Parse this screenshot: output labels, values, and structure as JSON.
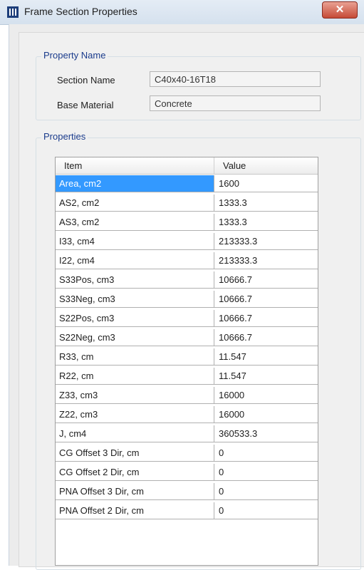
{
  "window": {
    "title": "Frame Section Properties",
    "close_glyph": "✕"
  },
  "property_name": {
    "legend": "Property Name",
    "section_name_label": "Section Name",
    "section_name_value": "C40x40-16T18",
    "base_material_label": "Base Material",
    "base_material_value": "Concrete"
  },
  "properties": {
    "legend": "Properties",
    "columns": [
      "Item",
      "Value"
    ],
    "rows": [
      {
        "item": "Area, cm2",
        "value": "1600"
      },
      {
        "item": "AS2, cm2",
        "value": "1333.3"
      },
      {
        "item": "AS3, cm2",
        "value": "1333.3"
      },
      {
        "item": "I33, cm4",
        "value": "213333.3"
      },
      {
        "item": "I22, cm4",
        "value": "213333.3"
      },
      {
        "item": "S33Pos, cm3",
        "value": "10666.7"
      },
      {
        "item": "S33Neg, cm3",
        "value": "10666.7"
      },
      {
        "item": "S22Pos, cm3",
        "value": "10666.7"
      },
      {
        "item": "S22Neg, cm3",
        "value": "10666.7"
      },
      {
        "item": "R33, cm",
        "value": "11.547"
      },
      {
        "item": "R22, cm",
        "value": "11.547"
      },
      {
        "item": "Z33, cm3",
        "value": "16000"
      },
      {
        "item": "Z22, cm3",
        "value": "16000"
      },
      {
        "item": "J, cm4",
        "value": "360533.3"
      },
      {
        "item": "CG Offset 3 Dir, cm",
        "value": "0"
      },
      {
        "item": "CG Offset 2 Dir, cm",
        "value": "0"
      },
      {
        "item": "PNA Offset 3 Dir, cm",
        "value": "0"
      },
      {
        "item": "PNA Offset 2 Dir, cm",
        "value": "0"
      }
    ],
    "selected_row": 0
  },
  "colors": {
    "selection": "#3399ff",
    "legend_text": "#1a3b8c",
    "close_button": "#c64a36"
  },
  "icons": {
    "app": "frame-section-app-icon",
    "close": "close-icon"
  }
}
